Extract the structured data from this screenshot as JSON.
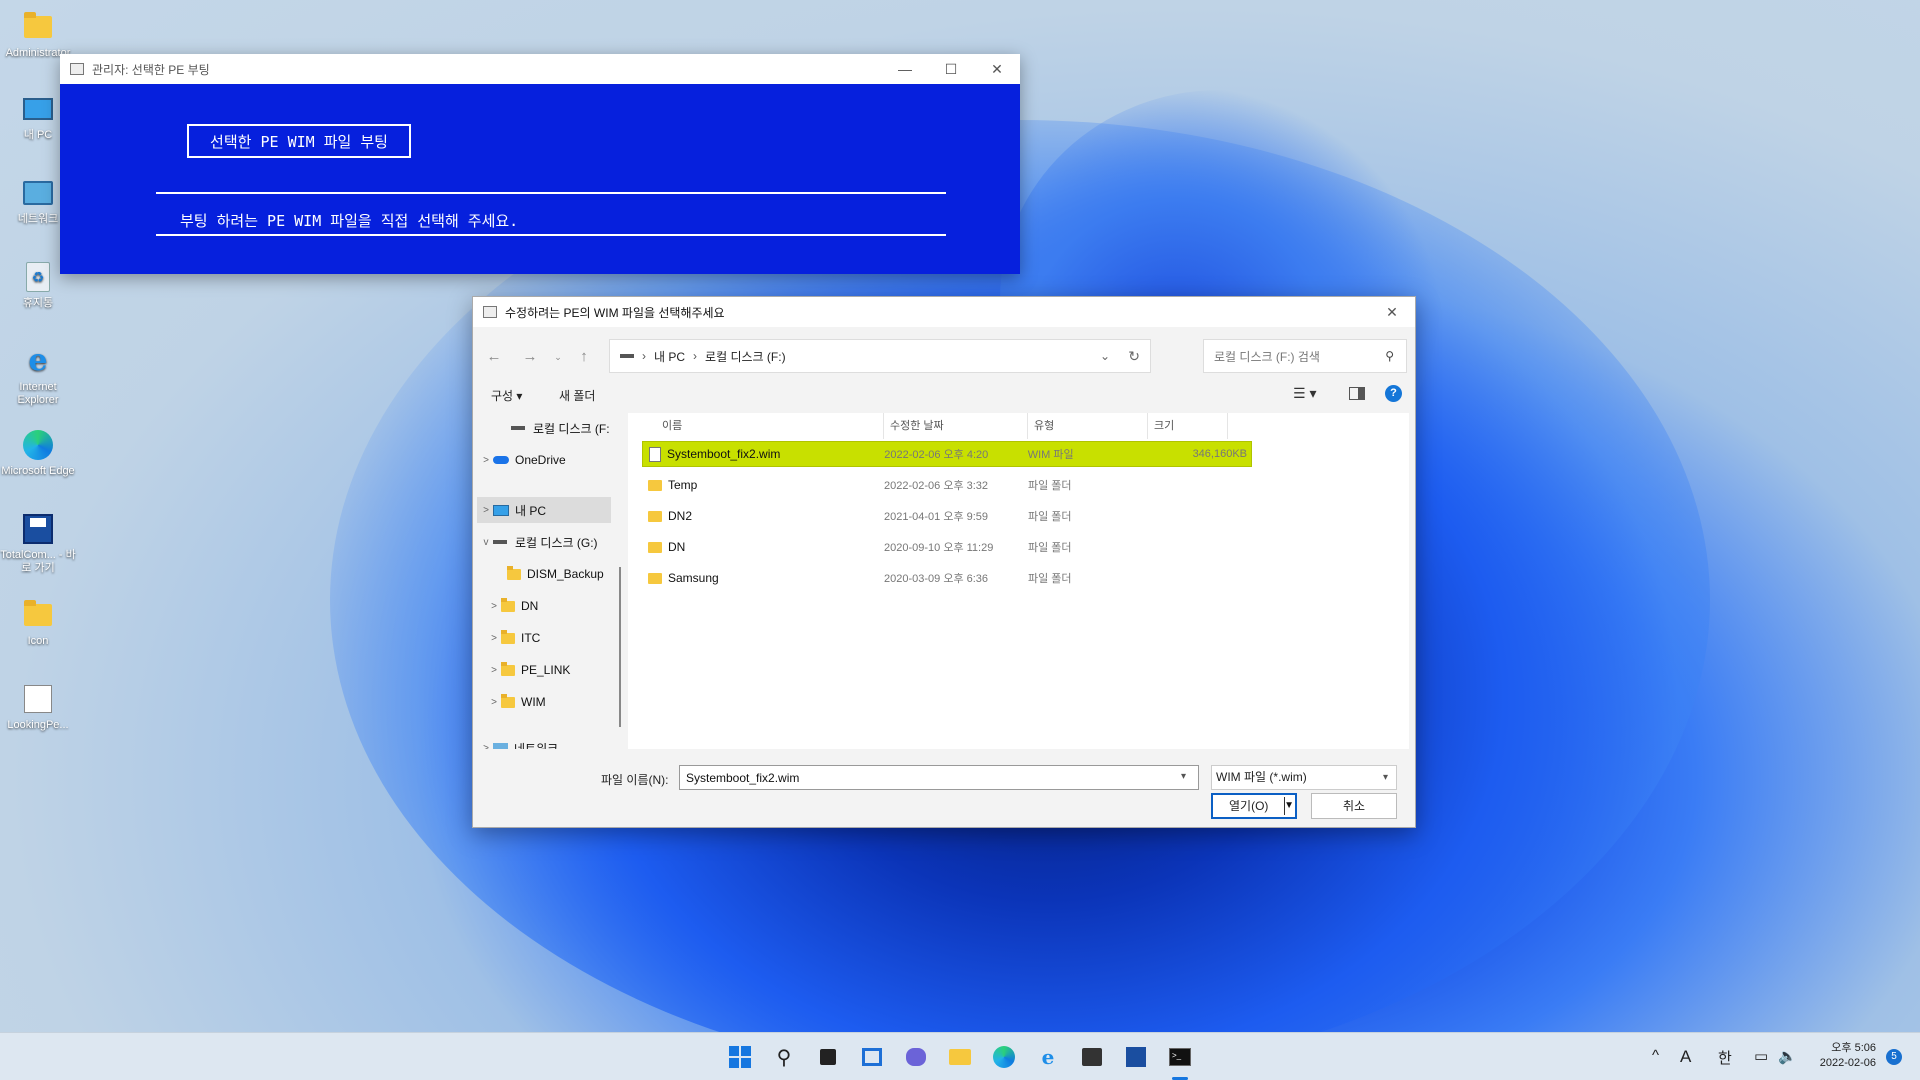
{
  "desktop": {
    "icons": [
      {
        "label": "Administrator",
        "icon": "folder-icon"
      },
      {
        "label": "내 PC",
        "icon": "computer-icon"
      },
      {
        "label": "네트워크",
        "icon": "network-icon"
      },
      {
        "label": "휴지통",
        "icon": "recycle-bin-icon"
      },
      {
        "label": "Internet Explorer",
        "icon": "internet-explorer-icon"
      },
      {
        "label": "Microsoft Edge",
        "icon": "edge-icon"
      },
      {
        "label": "TotalCom... - 바로 가기",
        "icon": "floppy-disk-icon"
      },
      {
        "label": "Icon",
        "icon": "folder-icon"
      },
      {
        "label": "LookingPe...",
        "icon": "lookingpe-icon"
      }
    ]
  },
  "pe_window": {
    "title": "관리자:  선택한 PE 부팅",
    "button_label": "선택한 PE WIM 파일 부팅",
    "message": "부팅 하려는 PE WIM 파일을 직접 선택해 주세요."
  },
  "dialog": {
    "title": "수정하려는 PE의 WIM 파일을 선택해주세요",
    "breadcrumb": [
      "내 PC",
      "로컬 디스크 (F:)"
    ],
    "search_placeholder": "로컬 디스크 (F:) 검색",
    "toolbar": {
      "organize": "구성 ▾",
      "new_folder": "새 폴더"
    },
    "nav": [
      {
        "label": "로컬 디스크 (F:",
        "icon": "drive-icon",
        "chevron": ""
      },
      {
        "label": "OneDrive",
        "icon": "cloud-icon",
        "chevron": ">"
      },
      {
        "label": "내 PC",
        "icon": "pc-icon",
        "chevron": ">"
      },
      {
        "label": "로컬 디스크 (G:)",
        "icon": "drive-icon",
        "chevron": "v"
      },
      {
        "label": "DISM_Backup",
        "icon": "folder-icon",
        "chevron": ""
      },
      {
        "label": "DN",
        "icon": "folder-icon",
        "chevron": ">"
      },
      {
        "label": "ITC",
        "icon": "folder-icon",
        "chevron": ">"
      },
      {
        "label": "PE_LINK",
        "icon": "folder-icon",
        "chevron": ">"
      },
      {
        "label": "WIM",
        "icon": "folder-icon",
        "chevron": ">"
      },
      {
        "label": "네트워크",
        "icon": "network-icon",
        "chevron": ">"
      }
    ],
    "columns": {
      "name": "이름",
      "modified": "수정한 날짜",
      "type": "유형",
      "size": "크기"
    },
    "files": [
      {
        "name": "Systemboot_fix2.wim",
        "modified": "2022-02-06 오후 4:20",
        "type": "WIM 파일",
        "size": "346,160KB",
        "kind": "file",
        "selected": true
      },
      {
        "name": "Temp",
        "modified": "2022-02-06 오후 3:32",
        "type": "파일 폴더",
        "size": "",
        "kind": "folder",
        "selected": false
      },
      {
        "name": "DN2",
        "modified": "2021-04-01 오후 9:59",
        "type": "파일 폴더",
        "size": "",
        "kind": "folder",
        "selected": false
      },
      {
        "name": "DN",
        "modified": "2020-09-10 오후 11:29",
        "type": "파일 폴더",
        "size": "",
        "kind": "folder",
        "selected": false
      },
      {
        "name": "Samsung",
        "modified": "2020-03-09 오후 6:36",
        "type": "파일 폴더",
        "size": "",
        "kind": "folder",
        "selected": false
      }
    ],
    "filename_label": "파일 이름(N):",
    "filename_value": "Systemboot_fix2.wim",
    "filetype_value": "WIM 파일 (*.wim)",
    "open_label": "열기(O)",
    "cancel_label": "취소"
  },
  "taskbar": {
    "icons": [
      "start-icon",
      "search-icon",
      "task-view-icon",
      "widgets-icon",
      "chat-icon",
      "file-explorer-icon",
      "edge-icon",
      "internet-explorer-icon",
      "store-icon",
      "floppy-disk-icon",
      "terminal-icon"
    ],
    "tray": {
      "chevron": "^",
      "ime_a": "A",
      "ime_han": "한",
      "time": "오후 5:06",
      "date": "2022-02-06",
      "notifications": "5"
    }
  }
}
